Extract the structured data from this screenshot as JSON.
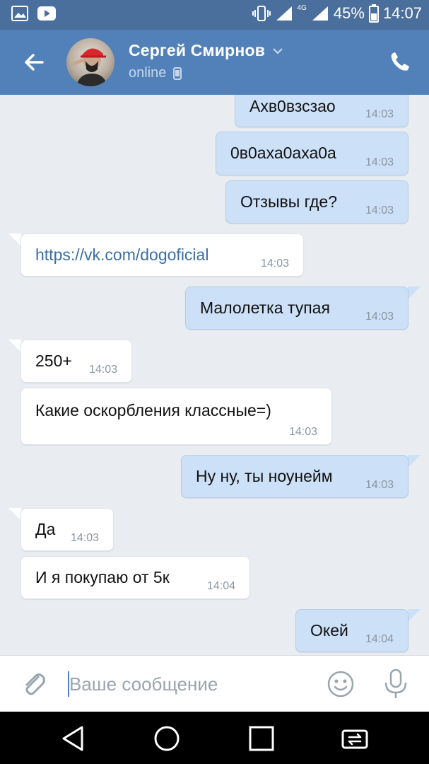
{
  "status_bar": {
    "network_label": "4G",
    "battery": "45%",
    "time": "14:07"
  },
  "header": {
    "name": "Сергей Смирнов",
    "status": "online"
  },
  "messages": [
    {
      "direction": "out",
      "text": "Ахв0взсзао",
      "time": "14:03"
    },
    {
      "direction": "out",
      "text": "0в0аха0аха0а",
      "time": "14:03"
    },
    {
      "direction": "out",
      "text": "Отзывы где?",
      "time": "14:03"
    },
    {
      "direction": "in",
      "text": "https://vk.com/dogoficial",
      "time": "14:03"
    },
    {
      "direction": "out",
      "text": "Малолетка тупая",
      "time": "14:03"
    },
    {
      "direction": "in",
      "text": "250+",
      "time": "14:03"
    },
    {
      "direction": "in",
      "text": "Какие оскорбления классные=)",
      "time": "14:03"
    },
    {
      "direction": "out",
      "text": "Ну ну, ты ноунейм",
      "time": "14:03"
    },
    {
      "direction": "in",
      "text": "Да",
      "time": "14:03"
    },
    {
      "direction": "in",
      "text": "И я покупаю от 5к",
      "time": "14:04"
    },
    {
      "direction": "out",
      "text": "Окей",
      "time": "14:04"
    }
  ],
  "composer": {
    "placeholder": "Ваше сообщение",
    "value": ""
  },
  "colors": {
    "header": "#5181b8",
    "status_bar": "#4a6f9c",
    "outgoing_bubble": "#cce0f7",
    "incoming_bubble": "#ffffff",
    "chat_background": "#e9edf2",
    "link": "#3a6fa8"
  },
  "icons": {
    "status_left": [
      "gallery-icon",
      "youtube-icon"
    ],
    "status_right": [
      "vibrate-icon",
      "signal-icon",
      "signal-4g-icon",
      "battery-icon"
    ],
    "header": [
      "back-arrow-icon",
      "chevron-down-icon",
      "mobile-icon",
      "phone-icon"
    ],
    "composer": [
      "attach-icon",
      "smile-icon",
      "microphone-icon"
    ],
    "navbar": [
      "back-triangle-icon",
      "home-circle-icon",
      "recents-square-icon",
      "screen-rotate-icon"
    ]
  }
}
